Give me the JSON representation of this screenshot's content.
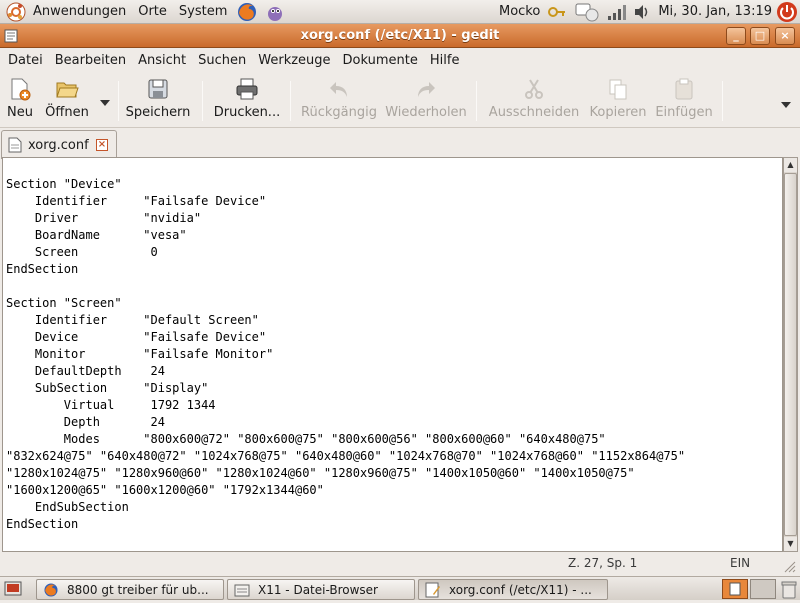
{
  "top_panel": {
    "menus": [
      "Anwendungen",
      "Orte",
      "System"
    ],
    "user": "Mocko",
    "clock": "Mi, 30. Jan, 13:19"
  },
  "window": {
    "title": "xorg.conf (/etc/X11) - gedit"
  },
  "menubar": [
    "Datei",
    "Bearbeiten",
    "Ansicht",
    "Suchen",
    "Werkzeuge",
    "Dokumente",
    "Hilfe"
  ],
  "toolbar": {
    "new": "Neu",
    "open": "Öffnen",
    "save": "Speichern",
    "print": "Drucken...",
    "undo": "Rückgängig",
    "redo": "Wiederholen",
    "cut": "Ausschneiden",
    "copy": "Kopieren",
    "paste": "Einfügen"
  },
  "tab": {
    "label": "xorg.conf"
  },
  "editor": {
    "lines": [
      "",
      "Section \"Device\"",
      "    Identifier     \"Failsafe Device\"",
      "    Driver         \"nvidia\"",
      "    BoardName      \"vesa\"",
      "    Screen          0",
      "EndSection",
      "",
      "Section \"Screen\"",
      "    Identifier     \"Default Screen\"",
      "    Device         \"Failsafe Device\"",
      "    Monitor        \"Failsafe Monitor\"",
      "    DefaultDepth    24",
      "    SubSection     \"Display\"",
      "        Virtual     1792 1344",
      "        Depth       24",
      "        Modes      \"800x600@72\" \"800x600@75\" \"800x600@56\" \"800x600@60\" \"640x480@75\"",
      "\"832x624@75\" \"640x480@72\" \"1024x768@75\" \"640x480@60\" \"1024x768@70\" \"1024x768@60\" \"1152x864@75\"",
      "\"1280x1024@75\" \"1280x960@60\" \"1280x1024@60\" \"1280x960@75\" \"1400x1050@60\" \"1400x1050@75\"",
      "\"1600x1200@65\" \"1600x1200@60\" \"1792x1344@60\"",
      "    EndSubSection",
      "EndSection"
    ]
  },
  "statusbar": {
    "position": "Z. 27, Sp. 1",
    "mode": "EIN"
  },
  "taskbar": [
    {
      "label": "8800 gt treiber für ub..."
    },
    {
      "label": "X11 - Datei-Browser"
    },
    {
      "label": "xorg.conf (/etc/X11) - ..."
    }
  ]
}
